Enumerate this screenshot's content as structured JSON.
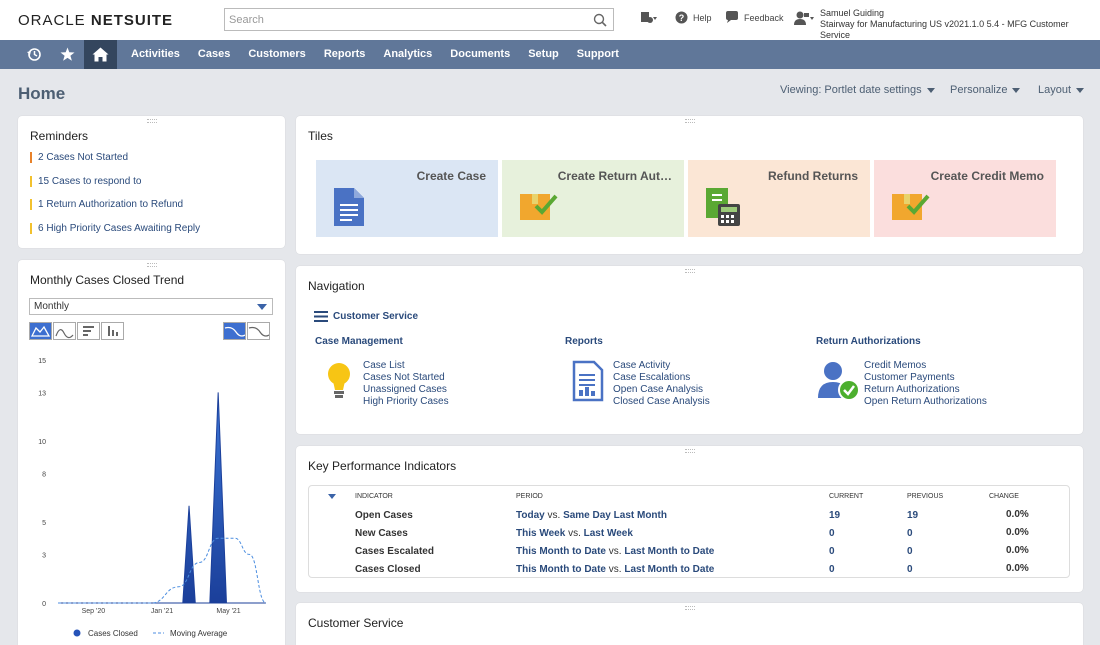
{
  "header": {
    "logo_light": "ORACLE ",
    "logo_bold": "NETSUITE",
    "search_placeholder": "Search",
    "help_label": "Help",
    "feedback_label": "Feedback",
    "user_name": "Samuel Guiding",
    "user_role": "Stairway for Manufacturing US v2021.1.0 5.4 - MFG Customer Service"
  },
  "nav": {
    "items": [
      "Activities",
      "Cases",
      "Customers",
      "Reports",
      "Analytics",
      "Documents",
      "Setup",
      "Support"
    ]
  },
  "page": {
    "title": "Home",
    "viewing": "Viewing: Portlet date settings",
    "personalize": "Personalize",
    "layout": "Layout"
  },
  "reminders": {
    "title": "Reminders",
    "items": [
      {
        "count": "2",
        "text": "Cases Not Started",
        "color": "#e8822a"
      },
      {
        "count": "15",
        "text": "Cases to respond to",
        "color": "#f2c12e"
      },
      {
        "count": "1",
        "text": "Return Authorization to Refund",
        "color": "#f2c12e"
      },
      {
        "count": "6",
        "text": "High Priority Cases Awaiting Reply",
        "color": "#f2c12e"
      }
    ]
  },
  "trend": {
    "title": "Monthly Cases Closed Trend",
    "period": "Monthly",
    "legend_closed": "Cases Closed",
    "legend_avg": "Moving Average"
  },
  "chart_data": {
    "type": "area",
    "ylim": [
      0,
      15
    ],
    "yticks": [
      "0",
      "3",
      "5",
      "8",
      "10",
      "13",
      "15"
    ],
    "xticks": [
      "Sep '20",
      "Jan '21",
      "May '21"
    ],
    "series": [
      {
        "name": "Cases Closed",
        "points": [
          [
            0,
            0
          ],
          [
            0.6,
            0
          ],
          [
            0.63,
            6
          ],
          [
            0.66,
            0
          ],
          [
            0.73,
            0
          ],
          [
            0.77,
            13
          ],
          [
            0.81,
            0
          ],
          [
            1,
            0
          ]
        ]
      },
      {
        "name": "Moving Average",
        "points": [
          [
            0,
            0
          ],
          [
            0.45,
            0
          ],
          [
            0.58,
            1
          ],
          [
            0.68,
            2.5
          ],
          [
            0.77,
            4
          ],
          [
            0.85,
            4
          ],
          [
            0.92,
            3
          ],
          [
            1,
            0
          ]
        ]
      }
    ]
  },
  "tiles": {
    "title": "Tiles",
    "items": [
      {
        "label": "Create Case",
        "bg": "#dbe6f4"
      },
      {
        "label": "Create Return Aut…",
        "bg": "#e7f1dc"
      },
      {
        "label": "Refund Returns",
        "bg": "#fbe6d5"
      },
      {
        "label": "Create Credit Memo",
        "bg": "#fbdedd"
      }
    ]
  },
  "navigation": {
    "title": "Navigation",
    "section": "Customer Service",
    "groups": [
      {
        "head": "Case Management",
        "links": [
          "Case List",
          "Cases Not Started",
          "Unassigned Cases",
          "High Priority Cases"
        ]
      },
      {
        "head": "Reports",
        "links": [
          "Case Activity",
          "Case Escalations",
          "Open Case Analysis",
          "Closed Case Analysis"
        ]
      },
      {
        "head": "Return Authorizations",
        "links": [
          "Credit Memos",
          "Customer Payments",
          "Return Authorizations",
          "Open Return Authorizations"
        ]
      }
    ]
  },
  "kpi": {
    "title": "Key Performance Indicators",
    "headers": [
      "INDICATOR",
      "PERIOD",
      "CURRENT",
      "PREVIOUS",
      "CHANGE"
    ],
    "rows": [
      {
        "indicator": "Open Cases",
        "p1": "Today",
        "p2": "Same Day Last Month",
        "current": "19",
        "previous": "19",
        "change": "0.0%"
      },
      {
        "indicator": "New Cases",
        "p1": "This Week",
        "p2": "Last Week",
        "current": "0",
        "previous": "0",
        "change": "0.0%"
      },
      {
        "indicator": "Cases Escalated",
        "p1": "This Month to Date",
        "p2": "Last Month to Date",
        "current": "0",
        "previous": "0",
        "change": "0.0%"
      },
      {
        "indicator": "Cases Closed",
        "p1": "This Month to Date",
        "p2": "Last Month to Date",
        "current": "0",
        "previous": "0",
        "change": "0.0%"
      }
    ],
    "vs": "vs."
  },
  "customer_service": {
    "title": "Customer Service"
  }
}
